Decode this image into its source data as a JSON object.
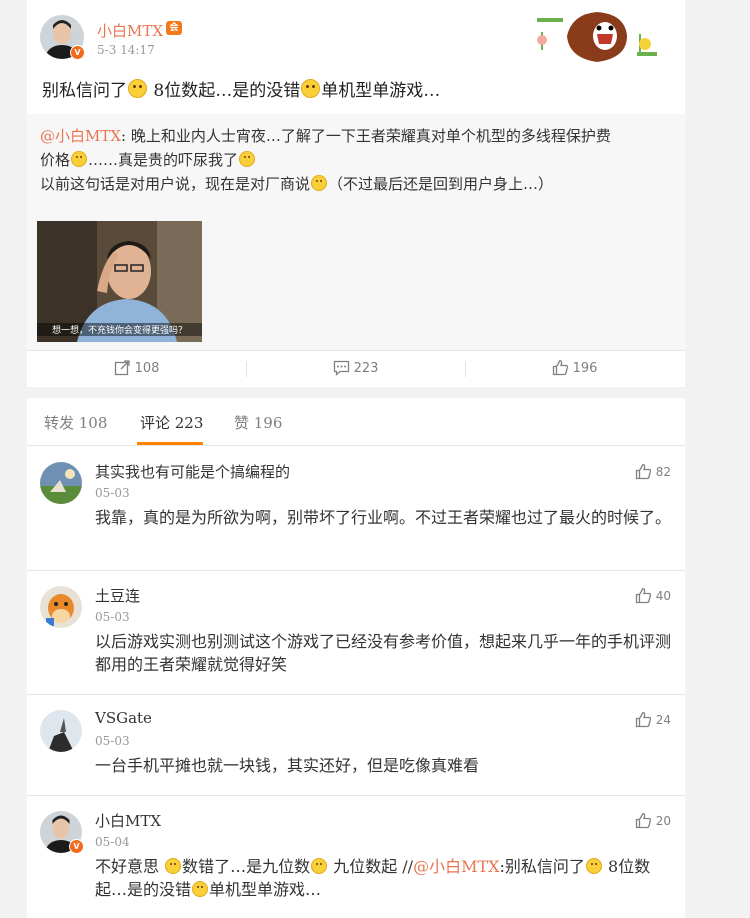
{
  "post": {
    "user_name": "小白MTX",
    "time": "5-3 14:17",
    "text_segments": [
      "别私信问了",
      " 8位数起…是的没错",
      "单机型单游戏…"
    ],
    "repost": {
      "mention": "@小白MTX",
      "line1": ": 晚上和业内人士宵夜…了解了一下王者荣耀真对单个机型的多线程保护费",
      "line2": "价格",
      "line2b": "……真是贵的吓尿我了",
      "line3": "以前这句话是对用户说，现在是对厂商说",
      "line3b": "（不过最后还是回到用户身上…）",
      "photo_caption": "想一想，不充钱你会变得更强吗？"
    },
    "actions": {
      "repost_count": "108",
      "comment_count": "223",
      "like_count": "196"
    }
  },
  "tabs": {
    "repost": "转发 108",
    "comment": "评论 223",
    "like": "赞 196"
  },
  "comments": [
    {
      "name": "其实我也有可能是个搞编程的",
      "date": "05-03",
      "likes": "82",
      "text": "我靠，真的是为所欲为啊，别带坏了行业啊。不过王者荣耀也过了最火的时候了。"
    },
    {
      "name": "土豆连",
      "date": "05-03",
      "likes": "40",
      "text": "以后游戏实测也别测试这个游戏了已经没有参考价值，想起来几乎一年的手机评测都用的王者荣耀就觉得好笑"
    },
    {
      "name": "VSGate",
      "date": "05-03",
      "likes": "24",
      "text": "一台手机平摊也就一块钱，其实还好，但是吃像真难看"
    },
    {
      "name": "小白MTX",
      "date": "05-04",
      "likes": "20",
      "text_a": "不好意思 ",
      "text_b": "数错了…是九位数",
      "text_c": " 九位数起 //",
      "mention": "@小白MTX",
      "text_d": ":别私信问了",
      "text_e": " 8位数起…是的没错",
      "text_f": "单机型单游戏…"
    }
  ]
}
